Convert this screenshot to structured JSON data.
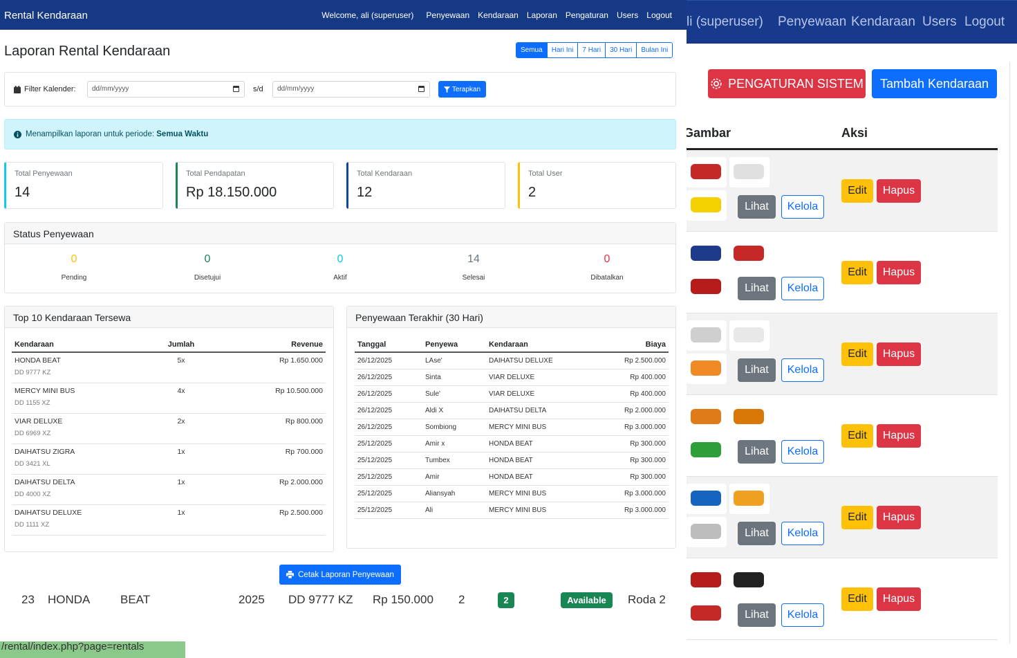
{
  "bg_window": {
    "nav": [
      "li (superuser)",
      "Penyewaan",
      "Kendaraan",
      "Users",
      "Logout"
    ],
    "settings_button": "PENGATURAN SISTEM",
    "add_vehicle_button": "Tambah Kendaraan",
    "col_gambar": "Gambar",
    "col_aksi": "Aksi",
    "row_buttons": {
      "lihat": "Lihat",
      "kelola": "Kelola",
      "edit": "Edit",
      "hapus": "Hapus"
    },
    "colors": {
      "nav": "#173a8c",
      "danger": "#dc3545",
      "primary": "#0d6efd",
      "warning": "#ffc107",
      "secondary": "#6c757d"
    }
  },
  "nav": {
    "brand": "Rental Kendaraan",
    "welcome": "Welcome, ali (superuser)",
    "links": [
      "Penyewaan",
      "Kendaraan",
      "Laporan",
      "Pengaturan",
      "Users",
      "Logout"
    ]
  },
  "page_title": "Laporan Rental Kendaraan",
  "ranges": [
    "Semua",
    "Hari Ini",
    "7 Hari",
    "30 Hari",
    "Bulan Ini"
  ],
  "filter": {
    "label": "Filter Kalender:",
    "from_placeholder": "dd/mm/yyyy",
    "sep": "s/d",
    "to_placeholder": "dd/mm/yyyy",
    "apply": "Terapkan"
  },
  "info": {
    "text": "Menampilkan laporan untuk periode:",
    "period": "Semua Waktu"
  },
  "stats": [
    {
      "label": "Total Penyewaan",
      "value": "14"
    },
    {
      "label": "Total Pendapatan",
      "value": "Rp 18.150.000"
    },
    {
      "label": "Total Kendaraan",
      "value": "12"
    },
    {
      "label": "Total User",
      "value": "2"
    }
  ],
  "status": {
    "title": "Status Penyewaan",
    "items": [
      {
        "label": "Pending",
        "value": "0",
        "color": "#ffc107"
      },
      {
        "label": "Disetujui",
        "value": "0",
        "color": "#198754"
      },
      {
        "label": "Aktif",
        "value": "0",
        "color": "#0dcaf0"
      },
      {
        "label": "Selesai",
        "value": "14",
        "color": "#6c757d"
      },
      {
        "label": "Dibatalkan",
        "value": "0",
        "color": "#dc3545"
      }
    ]
  },
  "top10": {
    "title": "Top 10 Kendaraan Tersewa",
    "headers": [
      "Kendaraan",
      "Jumlah",
      "Revenue"
    ],
    "rows": [
      {
        "name": "HONDA BEAT",
        "plate": "DD 9777 KZ",
        "count": "5x",
        "revenue": "Rp 1.650.000"
      },
      {
        "name": "MERCY MINI BUS",
        "plate": "DD 1155 XZ",
        "count": "4x",
        "revenue": "Rp 10.500.000"
      },
      {
        "name": "VIAR DELUXE",
        "plate": "DD 6969 XZ",
        "count": "2x",
        "revenue": "Rp 800.000"
      },
      {
        "name": "DAIHATSU ZIGRA",
        "plate": "DD 3421 XL",
        "count": "1x",
        "revenue": "Rp 700.000"
      },
      {
        "name": "DAIHATSU DELTA",
        "plate": "DD 4000 XZ",
        "count": "1x",
        "revenue": "Rp 2.000.000"
      },
      {
        "name": "DAIHATSU DELUXE",
        "plate": "DD 1111 XZ",
        "count": "1x",
        "revenue": "Rp 2.500.000"
      }
    ]
  },
  "recent": {
    "title": "Penyewaan Terakhir (30 Hari)",
    "headers": [
      "Tanggal",
      "Penyewa",
      "Kendaraan",
      "Biaya"
    ],
    "rows": [
      [
        "26/12/2025",
        "LAse'",
        "DAIHATSU DELUXE",
        "Rp 2.500.000"
      ],
      [
        "26/12/2025",
        "Sinta",
        "VIAR DELUXE",
        "Rp 400.000"
      ],
      [
        "26/12/2025",
        "Sule'",
        "VIAR DELUXE",
        "Rp 400.000"
      ],
      [
        "26/12/2025",
        "Aldi X",
        "DAIHATSU DELTA",
        "Rp 2.000.000"
      ],
      [
        "26/12/2025",
        "Sombiong",
        "MERCY MINI BUS",
        "Rp 3.000.000"
      ],
      [
        "25/12/2025",
        "Amir x",
        "HONDA BEAT",
        "Rp 300.000"
      ],
      [
        "25/12/2025",
        "Tumbex",
        "HONDA BEAT",
        "Rp 300.000"
      ],
      [
        "25/12/2025",
        "Amir",
        "HONDA BEAT",
        "Rp 300.000"
      ],
      [
        "25/12/2025",
        "Aliansyah",
        "MERCY MINI BUS",
        "Rp 3.000.000"
      ],
      [
        "25/12/2025",
        "Ali",
        "MERCY MINI BUS",
        "Rp 3.000.000"
      ]
    ]
  },
  "print_button": "Cetak Laporan Penyewaan",
  "bottom_row": {
    "no": "23",
    "brand": "HONDA",
    "model": "BEAT",
    "year": "2025",
    "plate": "DD 9777 KZ",
    "price": "Rp 150.000",
    "stock": "2",
    "badge": "2",
    "status": "Available",
    "type": "Roda 2"
  },
  "url_status": "/rental/index.php?page=rentals"
}
